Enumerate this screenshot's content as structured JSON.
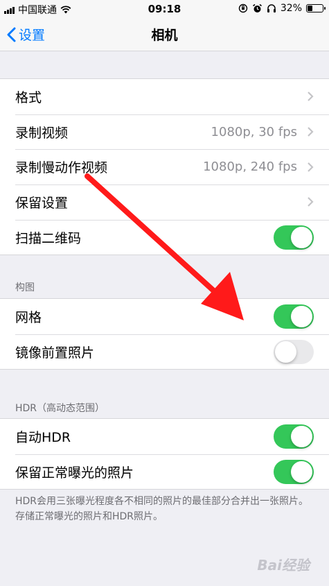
{
  "status_bar": {
    "carrier": "中国联通",
    "time": "09:18",
    "battery_percent": "32%",
    "battery_level": 0.32,
    "icons": [
      "signal-icon",
      "wifi-icon",
      "orientation-lock-icon",
      "alarm-icon",
      "headphones-icon",
      "battery-icon"
    ]
  },
  "nav": {
    "back_label": "设置",
    "title": "相机"
  },
  "group1": {
    "rows": [
      {
        "label": "格式",
        "value": "",
        "accessory": "chevron"
      },
      {
        "label": "录制视频",
        "value": "1080p, 30 fps",
        "accessory": "chevron"
      },
      {
        "label": "录制慢动作视频",
        "value": "1080p, 240 fps",
        "accessory": "chevron"
      },
      {
        "label": "保留设置",
        "value": "",
        "accessory": "chevron"
      },
      {
        "label": "扫描二维码",
        "value": "",
        "accessory": "toggle",
        "toggle_on": true
      }
    ]
  },
  "composition": {
    "header": "构图",
    "rows": [
      {
        "label": "网格",
        "accessory": "toggle",
        "toggle_on": true
      },
      {
        "label": "镜像前置照片",
        "accessory": "toggle",
        "toggle_on": false
      }
    ]
  },
  "hdr": {
    "header": "HDR（高动态范围）",
    "rows": [
      {
        "label": "自动HDR",
        "accessory": "toggle",
        "toggle_on": true
      },
      {
        "label": "保留正常曝光的照片",
        "accessory": "toggle",
        "toggle_on": true
      }
    ],
    "footer": "HDR会用三张曝光程度各不相同的照片的最佳部分合并出一张照片。存储正常曝光的照片和HDR照片。"
  },
  "colors": {
    "accent": "#007aff",
    "toggle_on": "#34c759",
    "annotation_arrow": "#ff1a1a"
  },
  "watermark": {
    "label": "Bai经验"
  }
}
